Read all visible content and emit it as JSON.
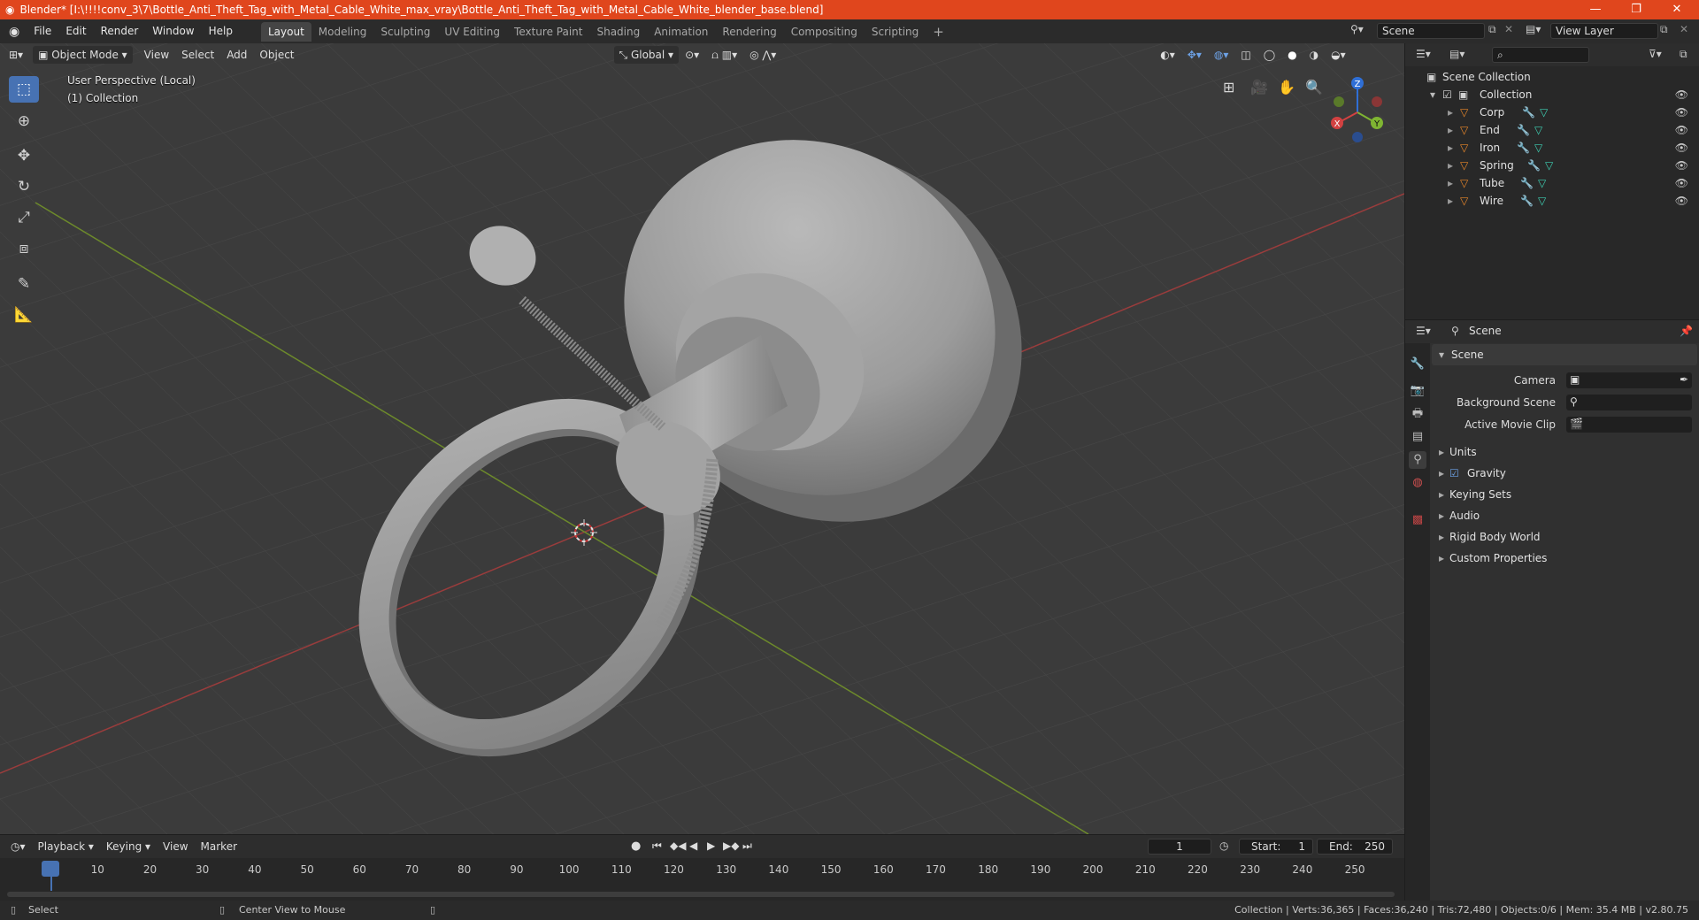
{
  "window": {
    "title": "Blender* [I:\\!!!!conv_3\\7\\Bottle_Anti_Theft_Tag_with_Metal_Cable_White_max_vray\\Bottle_Anti_Theft_Tag_with_Metal_Cable_White_blender_base.blend]"
  },
  "menubar": [
    "File",
    "Edit",
    "Render",
    "Window",
    "Help"
  ],
  "workspaces": [
    {
      "label": "Layout",
      "active": true
    },
    {
      "label": "Modeling"
    },
    {
      "label": "Sculpting"
    },
    {
      "label": "UV Editing"
    },
    {
      "label": "Texture Paint"
    },
    {
      "label": "Shading"
    },
    {
      "label": "Animation"
    },
    {
      "label": "Rendering"
    },
    {
      "label": "Compositing"
    },
    {
      "label": "Scripting"
    }
  ],
  "scene_field": "Scene",
  "view_layer_field": "View Layer",
  "viewport": {
    "mode": "Object Mode",
    "menus": [
      "View",
      "Select",
      "Add",
      "Object"
    ],
    "orientation": "Global",
    "overlay_line1": "User Perspective (Local)",
    "overlay_line2": "(1) Collection",
    "gizmo": {
      "x": "X",
      "y": "Y",
      "z": "Z"
    }
  },
  "outliner": {
    "root": "Scene Collection",
    "collection": "Collection",
    "objects": [
      "Corp",
      "End",
      "Iron",
      "Spring",
      "Tube",
      "Wire"
    ]
  },
  "properties": {
    "header": "Scene",
    "section": "Scene",
    "fields": [
      {
        "label": "Camera"
      },
      {
        "label": "Background Scene"
      },
      {
        "label": "Active Movie Clip"
      }
    ],
    "subsections": [
      "Units",
      "Gravity",
      "Keying Sets",
      "Audio",
      "Rigid Body World",
      "Custom Properties"
    ]
  },
  "timeline": {
    "menus": [
      "Playback",
      "Keying",
      "View",
      "Marker"
    ],
    "current_frame": "1",
    "start_label": "Start:",
    "start": "1",
    "end_label": "End:",
    "end": "250",
    "ticks": [
      "1",
      "10",
      "20",
      "30",
      "40",
      "50",
      "60",
      "70",
      "80",
      "90",
      "100",
      "110",
      "120",
      "130",
      "140",
      "150",
      "160",
      "170",
      "180",
      "190",
      "200",
      "210",
      "220",
      "230",
      "240",
      "250"
    ]
  },
  "statusbar": {
    "left": "Select",
    "middle": "Center View to Mouse",
    "right": "Collection | Verts:36,365 | Faces:36,240 | Tris:72,480 | Objects:0/6 | Mem: 35.4 MB | v2.80.75"
  },
  "colors": {
    "accent": "#4772b3",
    "titlebar": "#e0461d",
    "object_icon": "#e8862a",
    "modifier_icon": "#6aa0e6",
    "mesh_icon": "#3ecfb2"
  }
}
